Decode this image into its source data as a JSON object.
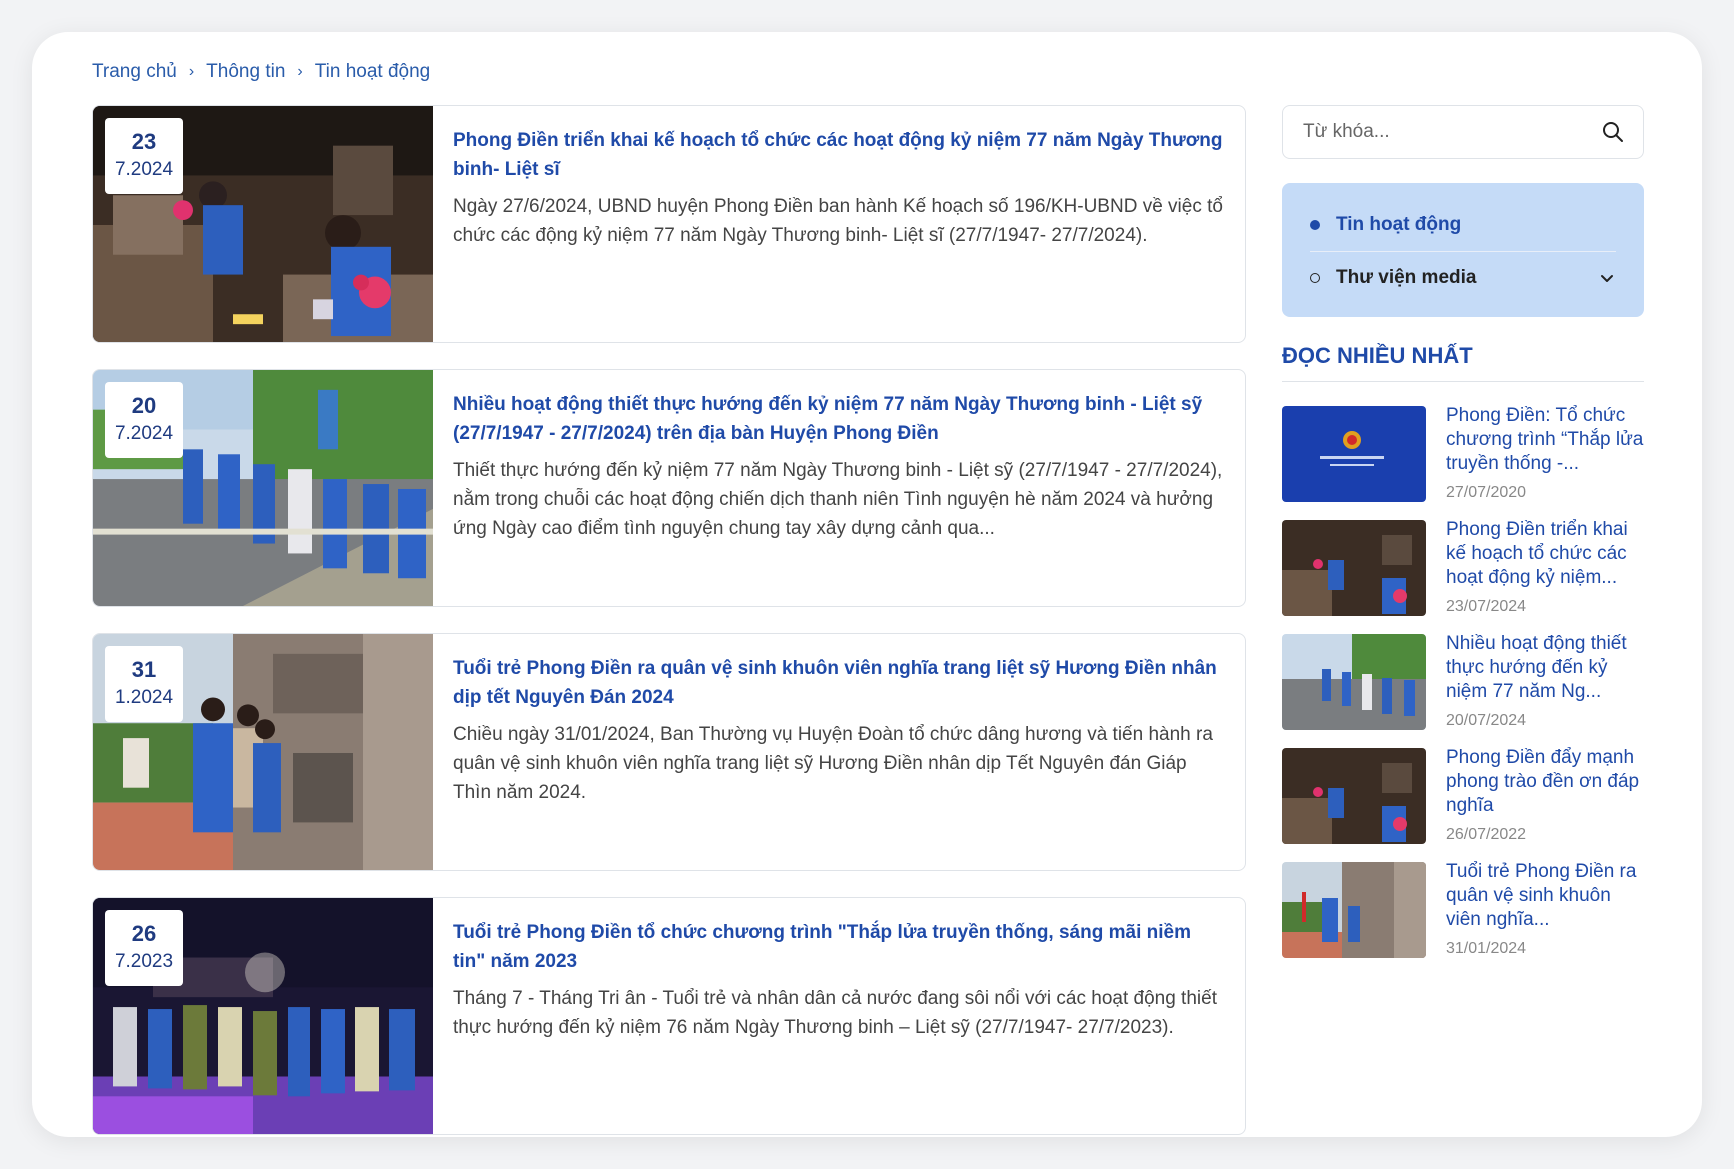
{
  "breadcrumb": [
    "Trang chủ",
    "Thông tin",
    "Tin hoạt động"
  ],
  "articles": [
    {
      "day": "23",
      "month_year": "7.2024",
      "title": "Phong Điền triển khai kế hoạch tổ chức các hoạt động kỷ niệm 77 năm Ngày Thương binh- Liệt sĩ",
      "desc": "Ngày 27/6/2024, UBND huyện Phong Điền ban hành Kế hoạch số 196/KH-UBND về việc tổ chức các động kỷ niệm 77 năm Ngày Thương binh- Liệt sĩ (27/7/1947- 27/7/2024)."
    },
    {
      "day": "20",
      "month_year": "7.2024",
      "title": "Nhiều hoạt động thiết thực hướng đến kỷ niệm 77 năm Ngày Thương binh - Liệt sỹ (27/7/1947 - 27/7/2024) trên địa bàn Huyện Phong Điền",
      "desc": "Thiết thực hướng đến kỷ niệm 77 năm Ngày Thương binh - Liệt sỹ (27/7/1947 - 27/7/2024), nằm trong chuỗi các hoạt động chiến dịch thanh niên Tình nguyện hè năm 2024 và hưởng ứng Ngày cao điểm tình nguyện chung tay xây dựng cảnh qua..."
    },
    {
      "day": "31",
      "month_year": "1.2024",
      "title": "Tuổi trẻ Phong Điền ra quân vệ sinh khuôn viên nghĩa trang liệt sỹ Hương Điền nhân dịp tết Nguyên Đán 2024",
      "desc": "Chiều ngày 31/01/2024, Ban Thường vụ Huyện Đoàn tổ chức dâng hương và tiến hành ra quân vệ sinh khuôn viên nghĩa trang liệt sỹ Hương Điền nhân dịp Tết Nguyên đán Giáp Thìn năm 2024."
    },
    {
      "day": "26",
      "month_year": "7.2023",
      "title": "Tuổi trẻ Phong Điền tổ chức chương trình \"Thắp lửa truyền thống, sáng mãi niềm tin\" năm 2023",
      "desc": "Tháng 7 - Tháng Tri ân - Tuổi trẻ và nhân dân cả nước đang sôi nổi với các hoạt động thiết thực hướng đến kỷ niệm 76 năm Ngày Thương binh – Liệt sỹ (27/7/1947- 27/7/2023)."
    }
  ],
  "sidebar": {
    "search_placeholder": "Từ khóa...",
    "categories": [
      {
        "label": "Tin hoạt động",
        "active": true
      },
      {
        "label": "Thư viện media",
        "active": false
      }
    ],
    "popular_heading": "ĐỌC NHIỀU NHẤT",
    "popular": [
      {
        "title": "Phong Điền: Tổ chức chương trình “Thắp lửa truyền thống -...",
        "date": "27/07/2020"
      },
      {
        "title": "Phong Điền triển khai kế hoạch tổ chức các hoạt động kỷ niệm...",
        "date": "23/07/2024"
      },
      {
        "title": "Nhiều hoạt động thiết thực hướng đến kỷ niệm 77 năm Ng...",
        "date": "20/07/2024"
      },
      {
        "title": "Phong Điền đẩy mạnh phong trào đền ơn đáp nghĩa",
        "date": "26/07/2022"
      },
      {
        "title": "Tuổi trẻ Phong Điền ra quân vệ sinh khuôn viên nghĩa...",
        "date": "31/01/2024"
      }
    ]
  },
  "colors": {
    "accent": "#1f4aa8",
    "category_bg": "#c5dbf7"
  }
}
